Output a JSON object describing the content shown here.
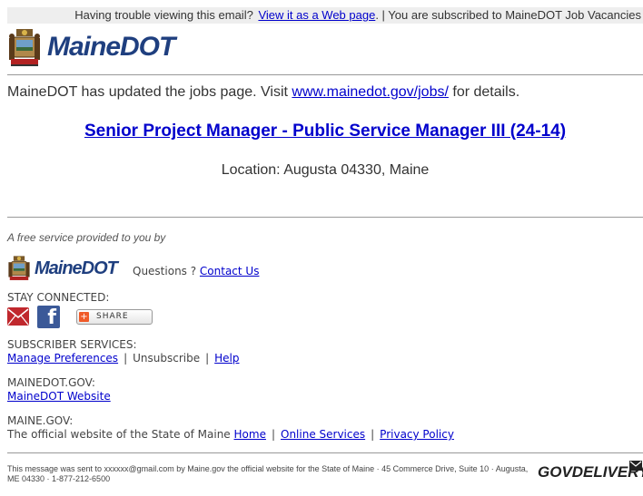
{
  "topbar": {
    "trouble_text": "Having trouble viewing this email?",
    "web_link": "View it as a Web page",
    "subscribed_text": ". | You are subscribed to MaineDOT Job Vacancies"
  },
  "header": {
    "logo_text": "MaineDOT"
  },
  "intro": {
    "text_before": "MaineDOT has updated the jobs page. Visit ",
    "link": "www.mainedot.gov/jobs/",
    "text_after": " for details."
  },
  "job": {
    "title": "Senior Project Manager - Public Service Manager III (24-14)",
    "location": "Location: Augusta 04330, Maine"
  },
  "footer_brand": {
    "free_service": "A free service provided to you by",
    "logo_text": "MaineDOT",
    "questions": "Questions ? ",
    "contact_link": "Contact Us"
  },
  "stay_connected": {
    "label": "STAY CONNECTED:",
    "share_label": "SHARE",
    "share_plus": "+",
    "facebook_glyph": "f"
  },
  "subscriber_services": {
    "label": "SUBSCRIBER SERVICES:",
    "manage": "Manage Preferences",
    "sep1": "|",
    "unsubscribe": "Unsubscribe",
    "sep2": "|",
    "help": "Help"
  },
  "mainedot_gov": {
    "label": "MAINEDOT.GOV:",
    "website": "MaineDOT Website"
  },
  "maine_gov": {
    "label": "MAINE.GOV:",
    "text": "The official website of the State of Maine ",
    "home": "Home",
    "sep1": "|",
    "online": "Online Services",
    "sep2": "|",
    "privacy": "Privacy Policy"
  },
  "footer": {
    "message": "This message was sent to xxxxxx@gmail.com by Maine.gov the official website for the State of Maine · 45 Commerce Drive, Suite 10 · Augusta, ME 04330 · 1-877-212-6500",
    "govdelivery": "GOVDELIVERY"
  },
  "colors": {
    "logo_blue": "#1f3f7f",
    "link_blue": "#0000cc",
    "facebook_blue": "#3b5998",
    "email_red": "#c0282d"
  },
  "icons": [
    "maine-seal-icon",
    "email-icon",
    "facebook-icon",
    "share-plus-icon",
    "envelope-icon"
  ]
}
